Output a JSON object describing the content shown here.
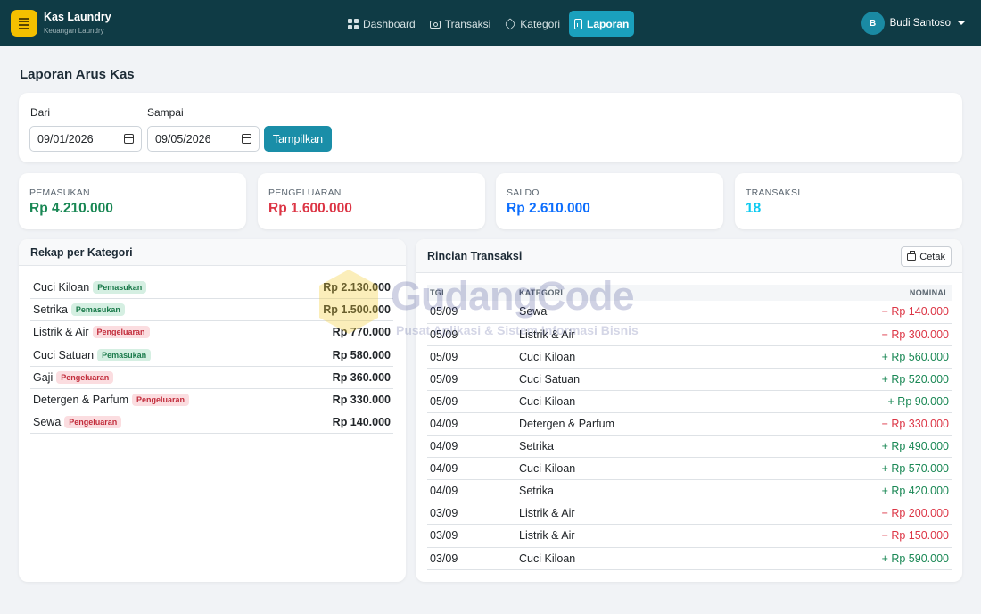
{
  "brand": {
    "name": "Kas Laundry",
    "subtitle": "Keuangan Laundry"
  },
  "nav": [
    {
      "label": "Dashboard",
      "icon": "dashboard-icon",
      "active": false
    },
    {
      "label": "Transaksi",
      "icon": "wallet-icon",
      "active": false
    },
    {
      "label": "Kategori",
      "icon": "tag-icon",
      "active": false
    },
    {
      "label": "Laporan",
      "icon": "report-icon",
      "active": true
    }
  ],
  "user": {
    "initial": "B",
    "name": "Budi Santoso"
  },
  "page": {
    "title": "Laporan Arus Kas"
  },
  "filter": {
    "from_label": "Dari",
    "from_value": "09/01/2026",
    "to_label": "Sampai",
    "to_value": "09/05/2026",
    "submit_label": "Tampilkan"
  },
  "stats": [
    {
      "label": "PEMASUKAN",
      "value": "Rp 4.210.000",
      "color": "#198754"
    },
    {
      "label": "PENGELUARAN",
      "value": "Rp 1.600.000",
      "color": "#dc3545"
    },
    {
      "label": "SALDO",
      "value": "Rp 2.610.000",
      "color": "#0d6efd"
    },
    {
      "label": "TRANSAKSI",
      "value": "18",
      "color": "#0dcaf0"
    }
  ],
  "rekap": {
    "title": "Rekap per Kategori",
    "rows": [
      {
        "name": "Cuci Kiloan",
        "type": "Pemasukan",
        "kind": "in",
        "amount": "Rp 2.130.000"
      },
      {
        "name": "Setrika",
        "type": "Pemasukan",
        "kind": "in",
        "amount": "Rp 1.500.000"
      },
      {
        "name": "Listrik & Air",
        "type": "Pengeluaran",
        "kind": "out",
        "amount": "Rp 770.000"
      },
      {
        "name": "Cuci Satuan",
        "type": "Pemasukan",
        "kind": "in",
        "amount": "Rp 580.000"
      },
      {
        "name": "Gaji",
        "type": "Pengeluaran",
        "kind": "out",
        "amount": "Rp 360.000"
      },
      {
        "name": "Detergen & Parfum",
        "type": "Pengeluaran",
        "kind": "out",
        "amount": "Rp 330.000"
      },
      {
        "name": "Sewa",
        "type": "Pengeluaran",
        "kind": "out",
        "amount": "Rp 140.000"
      }
    ]
  },
  "rincian": {
    "title": "Rincian Transaksi",
    "print_label": "Cetak",
    "columns": {
      "date": "TGL",
      "category": "KATEGORI",
      "amount": "NOMINAL"
    },
    "rows": [
      {
        "date": "05/09",
        "category": "Sewa",
        "amount": "− Rp 140.000",
        "kind": "out"
      },
      {
        "date": "05/09",
        "category": "Listrik & Air",
        "amount": "− Rp 300.000",
        "kind": "out"
      },
      {
        "date": "05/09",
        "category": "Cuci Kiloan",
        "amount": "+ Rp 560.000",
        "kind": "in"
      },
      {
        "date": "05/09",
        "category": "Cuci Satuan",
        "amount": "+ Rp 520.000",
        "kind": "in"
      },
      {
        "date": "05/09",
        "category": "Cuci Kiloan",
        "amount": "+ Rp 90.000",
        "kind": "in"
      },
      {
        "date": "04/09",
        "category": "Detergen & Parfum",
        "amount": "− Rp 330.000",
        "kind": "out"
      },
      {
        "date": "04/09",
        "category": "Setrika",
        "amount": "+ Rp 490.000",
        "kind": "in"
      },
      {
        "date": "04/09",
        "category": "Cuci Kiloan",
        "amount": "+ Rp 570.000",
        "kind": "in"
      },
      {
        "date": "04/09",
        "category": "Setrika",
        "amount": "+ Rp 420.000",
        "kind": "in"
      },
      {
        "date": "03/09",
        "category": "Listrik & Air",
        "amount": "− Rp 200.000",
        "kind": "out"
      },
      {
        "date": "03/09",
        "category": "Listrik & Air",
        "amount": "− Rp 150.000",
        "kind": "out"
      },
      {
        "date": "03/09",
        "category": "Cuci Kiloan",
        "amount": "+ Rp 590.000",
        "kind": "in"
      }
    ]
  },
  "watermark": {
    "title": "GudangCode",
    "subtitle": "Pusat Aplikasi & Sistem Informasi Bisnis"
  }
}
